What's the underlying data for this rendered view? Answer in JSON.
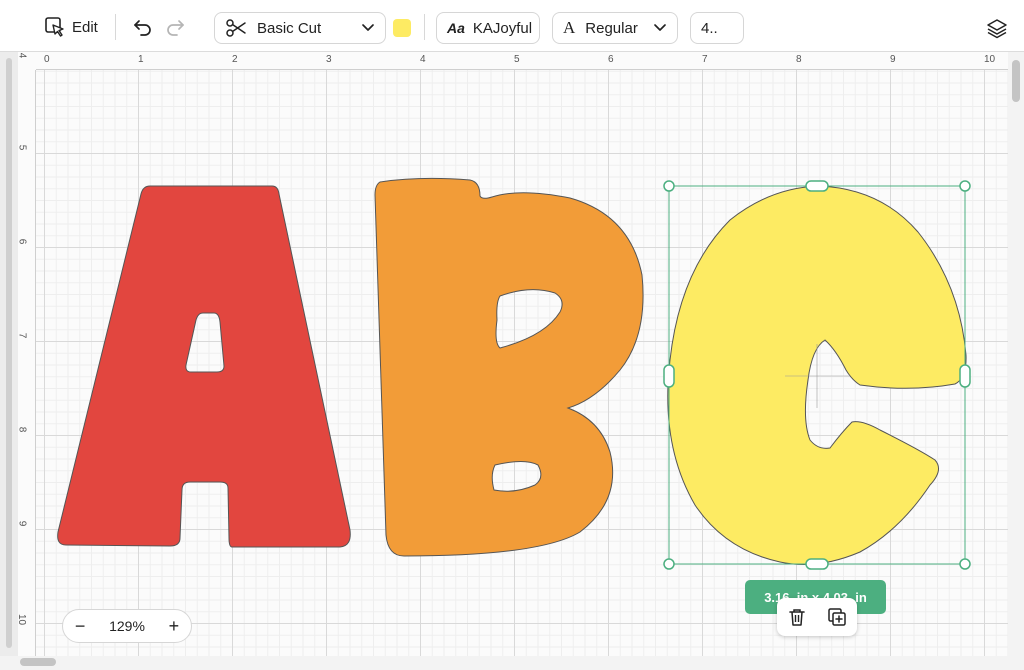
{
  "toolbar": {
    "edit_label": "Edit",
    "operation": "Basic Cut",
    "color_swatch": "#fdeb63",
    "font_label": "Aa",
    "font_name": "KAJoyful",
    "style_label": "Regular",
    "style_icon_letter": "A",
    "font_size": "4.."
  },
  "ruler": {
    "top": [
      "0",
      "1",
      "2",
      "3",
      "4",
      "5",
      "6",
      "7",
      "8",
      "9",
      "10"
    ],
    "left": [
      "4",
      "5",
      "6",
      "7",
      "8",
      "9",
      "10"
    ]
  },
  "letters": [
    {
      "char": "A",
      "color": "#e2463f"
    },
    {
      "char": "B",
      "color": "#f29c38"
    },
    {
      "char": "C",
      "color": "#fdeb63"
    }
  ],
  "selection": {
    "size_text": "3.16  in x 4.03  in",
    "color": "#4caf80"
  },
  "zoom": {
    "minus": "−",
    "level": "129%",
    "plus": "+"
  }
}
